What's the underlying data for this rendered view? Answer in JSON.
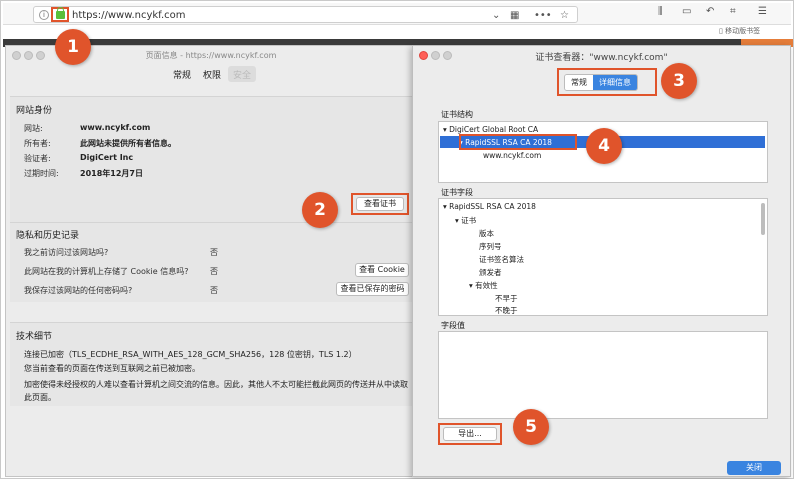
{
  "browser": {
    "url": "https://www.ncykf.com",
    "bookmark_label": "移动版书签"
  },
  "page_info": {
    "title": "页面信息 - https://www.ncykf.com",
    "tabs": [
      "常规",
      "权限",
      "安全"
    ],
    "identity": {
      "heading": "网站身份",
      "rows": [
        {
          "label": "网站:",
          "value": "www.ncykf.com"
        },
        {
          "label": "所有者:",
          "value": "此网站未提供所有者信息。"
        },
        {
          "label": "验证者:",
          "value": "DigiCert Inc"
        },
        {
          "label": "过期时间:",
          "value": "2018年12月7日"
        }
      ],
      "view_cert_button": "查看证书"
    },
    "privacy": {
      "heading": "隐私和历史记录",
      "rows": [
        {
          "question": "我之前访问过该网站吗?",
          "answer": "否"
        },
        {
          "question": "此网站在我的计算机上存储了 Cookie 信息吗?",
          "answer": "否",
          "button": "查看 Cookie"
        },
        {
          "question": "我保存过该网站的任何密码吗?",
          "answer": "否",
          "button": "查看已保存的密码"
        }
      ]
    },
    "technical": {
      "heading": "技术细节",
      "lines": [
        "连接已加密（TLS_ECDHE_RSA_WITH_AES_128_GCM_SHA256，128 位密钥，TLS 1.2）",
        "您当前查看的页面在传送到互联网之前已被加密。",
        "加密使得未经授权的人难以查看计算机之间交流的信息。因此，其他人不太可能拦截此网页的传送并从中读取",
        "此页面。"
      ]
    }
  },
  "cert_viewer": {
    "title": "证书查看器：\"www.ncykf.com\"",
    "tabs": [
      "常规",
      "详细信息"
    ],
    "active_tab": "详细信息",
    "structure_label": "证书结构",
    "structure": [
      "DigiCert Global Root CA",
      "RapidSSL RSA CA 2018",
      "www.ncykf.com"
    ],
    "fields_label": "证书字段",
    "fields": [
      "RapidSSL RSA CA 2018",
      "证书",
      "版本",
      "序列号",
      "证书签名算法",
      "颁发者",
      "有效性",
      "不早于",
      "不晚于"
    ],
    "field_value_label": "字段值",
    "export_button": "导出...",
    "close_button": "关闭"
  },
  "callouts": [
    "1",
    "2",
    "3",
    "4",
    "5"
  ],
  "colors": {
    "highlight": "#e0542b",
    "accent": "#3a84e0",
    "lock": "#5bbf3a"
  }
}
